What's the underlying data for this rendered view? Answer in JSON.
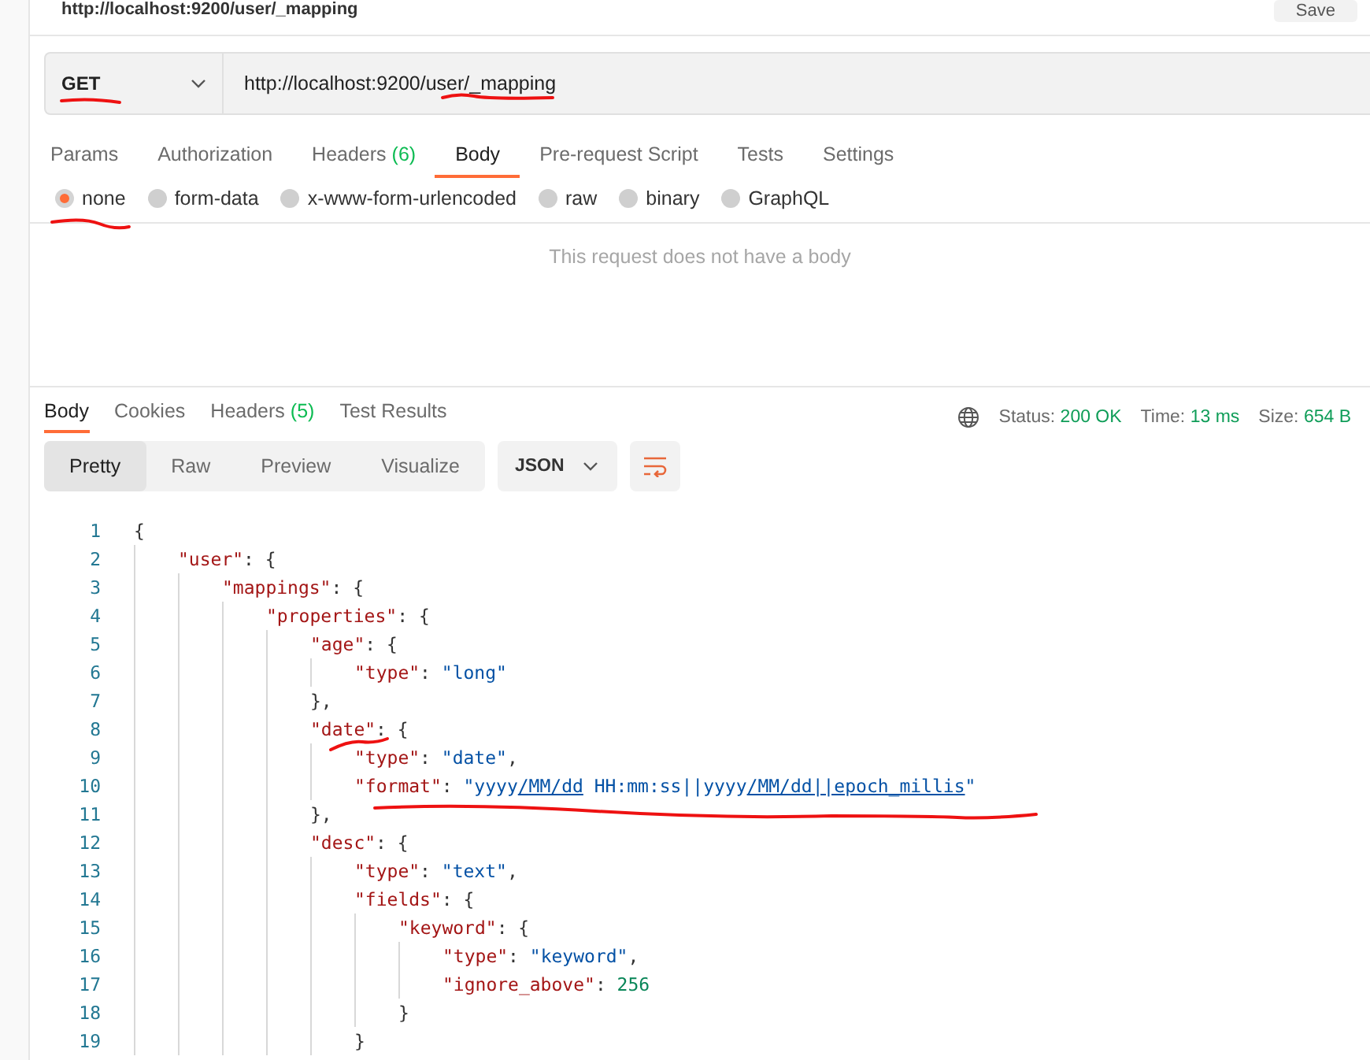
{
  "request_title": "http://localhost:9200/user/_mapping",
  "save_button": "Save",
  "request": {
    "method": "GET",
    "url": "http://localhost:9200/user/_mapping"
  },
  "request_tabs": [
    {
      "label": "Params",
      "selected": false
    },
    {
      "label": "Authorization",
      "selected": false
    },
    {
      "label": "Headers",
      "count": "(6)",
      "selected": false
    },
    {
      "label": "Body",
      "selected": true
    },
    {
      "label": "Pre-request Script",
      "selected": false
    },
    {
      "label": "Tests",
      "selected": false
    },
    {
      "label": "Settings",
      "selected": false
    }
  ],
  "body_types": [
    {
      "label": "none",
      "selected": true
    },
    {
      "label": "form-data",
      "selected": false
    },
    {
      "label": "x-www-form-urlencoded",
      "selected": false
    },
    {
      "label": "raw",
      "selected": false
    },
    {
      "label": "binary",
      "selected": false
    },
    {
      "label": "GraphQL",
      "selected": false
    }
  ],
  "empty_body_message": "This request does not have a body",
  "response_tabs": [
    {
      "label": "Body",
      "selected": true
    },
    {
      "label": "Cookies",
      "selected": false
    },
    {
      "label": "Headers",
      "count": "(5)",
      "selected": false
    },
    {
      "label": "Test Results",
      "selected": false
    }
  ],
  "response_meta": [
    {
      "label": "Status:",
      "value": "200 OK"
    },
    {
      "label": "Time:",
      "value": "13 ms"
    },
    {
      "label": "Size:",
      "value": "654 B"
    }
  ],
  "view_modes": [
    {
      "label": "Pretty",
      "selected": true
    },
    {
      "label": "Raw",
      "selected": false
    },
    {
      "label": "Preview",
      "selected": false
    },
    {
      "label": "Visualize",
      "selected": false
    }
  ],
  "format_select": "JSON",
  "code_lines": [
    {
      "number": "1",
      "tokens": [
        {
          "kind": "punct",
          "text": "{"
        }
      ]
    },
    {
      "number": "2",
      "tokens": [
        {
          "kind": "key",
          "text": "\"user\""
        },
        {
          "kind": "punct",
          "text": ": {"
        }
      ]
    },
    {
      "number": "3",
      "tokens": [
        {
          "kind": "key",
          "text": "\"mappings\""
        },
        {
          "kind": "punct",
          "text": ": {"
        }
      ]
    },
    {
      "number": "4",
      "tokens": [
        {
          "kind": "key",
          "text": "\"properties\""
        },
        {
          "kind": "punct",
          "text": ": {"
        }
      ]
    },
    {
      "number": "5",
      "tokens": [
        {
          "kind": "key",
          "text": "\"age\""
        },
        {
          "kind": "punct",
          "text": ": {"
        }
      ]
    },
    {
      "number": "6",
      "tokens": [
        {
          "kind": "key",
          "text": "\"type\""
        },
        {
          "kind": "punct",
          "text": ": "
        },
        {
          "kind": "string",
          "text": "\"long\""
        }
      ]
    },
    {
      "number": "7",
      "tokens": [
        {
          "kind": "punct",
          "text": "},"
        }
      ]
    },
    {
      "number": "8",
      "tokens": [
        {
          "kind": "key",
          "text": "\"date\""
        },
        {
          "kind": "punct",
          "text": ": {"
        }
      ]
    },
    {
      "number": "9",
      "tokens": [
        {
          "kind": "key",
          "text": "\"type\""
        },
        {
          "kind": "punct",
          "text": ": "
        },
        {
          "kind": "string",
          "text": "\"date\""
        },
        {
          "kind": "punct",
          "text": ","
        }
      ]
    },
    {
      "number": "10",
      "tokens": [
        {
          "kind": "key",
          "text": "\"format\""
        },
        {
          "kind": "punct",
          "text": ": "
        },
        {
          "kind": "string",
          "text": "\"yyyy"
        },
        {
          "kind": "link",
          "text": "/MM/dd"
        },
        {
          "kind": "string",
          "text": " HH:mm:ss||yyyy"
        },
        {
          "kind": "link",
          "text": "/MM/dd||epoch_millis"
        },
        {
          "kind": "string",
          "text": "\""
        }
      ]
    },
    {
      "number": "11",
      "tokens": [
        {
          "kind": "punct",
          "text": "},"
        }
      ]
    },
    {
      "number": "12",
      "tokens": [
        {
          "kind": "key",
          "text": "\"desc\""
        },
        {
          "kind": "punct",
          "text": ": {"
        }
      ]
    },
    {
      "number": "13",
      "tokens": [
        {
          "kind": "key",
          "text": "\"type\""
        },
        {
          "kind": "punct",
          "text": ": "
        },
        {
          "kind": "string",
          "text": "\"text\""
        },
        {
          "kind": "punct",
          "text": ","
        }
      ]
    },
    {
      "number": "14",
      "tokens": [
        {
          "kind": "key",
          "text": "\"fields\""
        },
        {
          "kind": "punct",
          "text": ": {"
        }
      ]
    },
    {
      "number": "15",
      "tokens": [
        {
          "kind": "key",
          "text": "\"keyword\""
        },
        {
          "kind": "punct",
          "text": ": {"
        }
      ]
    },
    {
      "number": "16",
      "tokens": [
        {
          "kind": "key",
          "text": "\"type\""
        },
        {
          "kind": "punct",
          "text": ": "
        },
        {
          "kind": "string",
          "text": "\"keyword\""
        },
        {
          "kind": "punct",
          "text": ","
        }
      ]
    },
    {
      "number": "17",
      "tokens": [
        {
          "kind": "key",
          "text": "\"ignore_above\""
        },
        {
          "kind": "punct",
          "text": ": "
        },
        {
          "kind": "number",
          "text": "256"
        }
      ]
    },
    {
      "number": "18",
      "tokens": [
        {
          "kind": "punct",
          "text": "}"
        }
      ]
    },
    {
      "number": "19",
      "tokens": [
        {
          "kind": "punct",
          "text": "}"
        }
      ]
    }
  ]
}
